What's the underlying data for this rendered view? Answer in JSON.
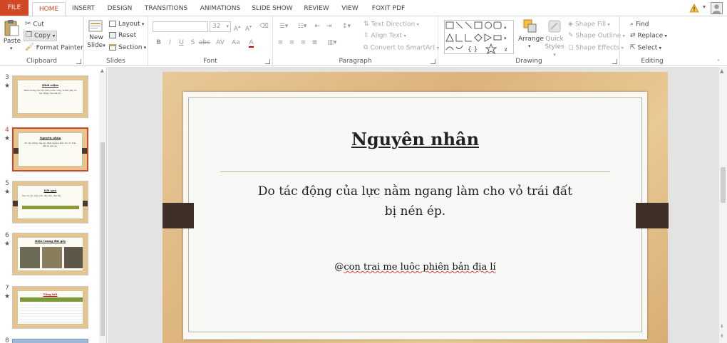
{
  "tabs": [
    "FILE",
    "HOME",
    "INSERT",
    "DESIGN",
    "TRANSITIONS",
    "ANIMATIONS",
    "SLIDE SHOW",
    "REVIEW",
    "VIEW",
    "FOXIT PDF"
  ],
  "colors": {
    "file_tab": "#d24726",
    "accent": "#d24726",
    "slide_wood": "#dcb37a",
    "slide_tab": "#3e3026"
  },
  "clipboard": {
    "paste": "Paste",
    "cut": "Cut",
    "copy": "Copy",
    "format_painter": "Format Painter",
    "label": "Clipboard"
  },
  "slides_group": {
    "new_slide_line1": "New",
    "new_slide_line2": "Slide",
    "layout": "Layout",
    "reset": "Reset",
    "section": "Section",
    "label": "Slides"
  },
  "font_group": {
    "font_size": "32",
    "bold": "B",
    "italic": "I",
    "underline": "U",
    "strike": "S",
    "shadow": "abc",
    "spacing": "AV",
    "case": "Aa",
    "label": "Font"
  },
  "paragraph_group": {
    "text_direction": "Text Direction",
    "align_text": "Align Text",
    "convert_smartart": "Convert to SmartArt",
    "label": "Paragraph"
  },
  "drawing_group": {
    "arrange": "Arrange",
    "quick_styles_line1": "Quick",
    "quick_styles_line2": "Styles",
    "shape_fill": "Shape Fill",
    "shape_outline": "Shape Outline",
    "shape_effects": "Shape Effects",
    "label": "Drawing"
  },
  "editing_group": {
    "find": "Find",
    "replace": "Replace",
    "select": "Select",
    "label": "Editing"
  },
  "thumbnails": [
    {
      "num": "3",
      "title": "Khái niệm",
      "body": "Hiện tượng các lớp đá bị uốn cong, bị đứt gãy do tác động của nội lực"
    },
    {
      "num": "4",
      "title": "Nguyên nhân",
      "body": "Do tác động của lực nằm ngang làm cho vỏ trái đất bị nén ép."
    },
    {
      "num": "5",
      "title": "Kết quả",
      "body": "Tạo ra các nếp uốn, địa hào, địa lũy"
    },
    {
      "num": "6",
      "title": "Hiện tượng đứt gãy",
      "body": ""
    },
    {
      "num": "7",
      "title": "Tổng kết",
      "body": ""
    },
    {
      "num": "8",
      "title": "",
      "body": ""
    }
  ],
  "slide": {
    "title": "Nguyên nhân",
    "body_line1": "Do tác động của lực nằm ngang làm cho vỏ trái đất",
    "body_line2": "bị nén ép.",
    "credit_prefix": "@",
    "credit_words": "con trai me luôc phiên bản địa lí"
  }
}
